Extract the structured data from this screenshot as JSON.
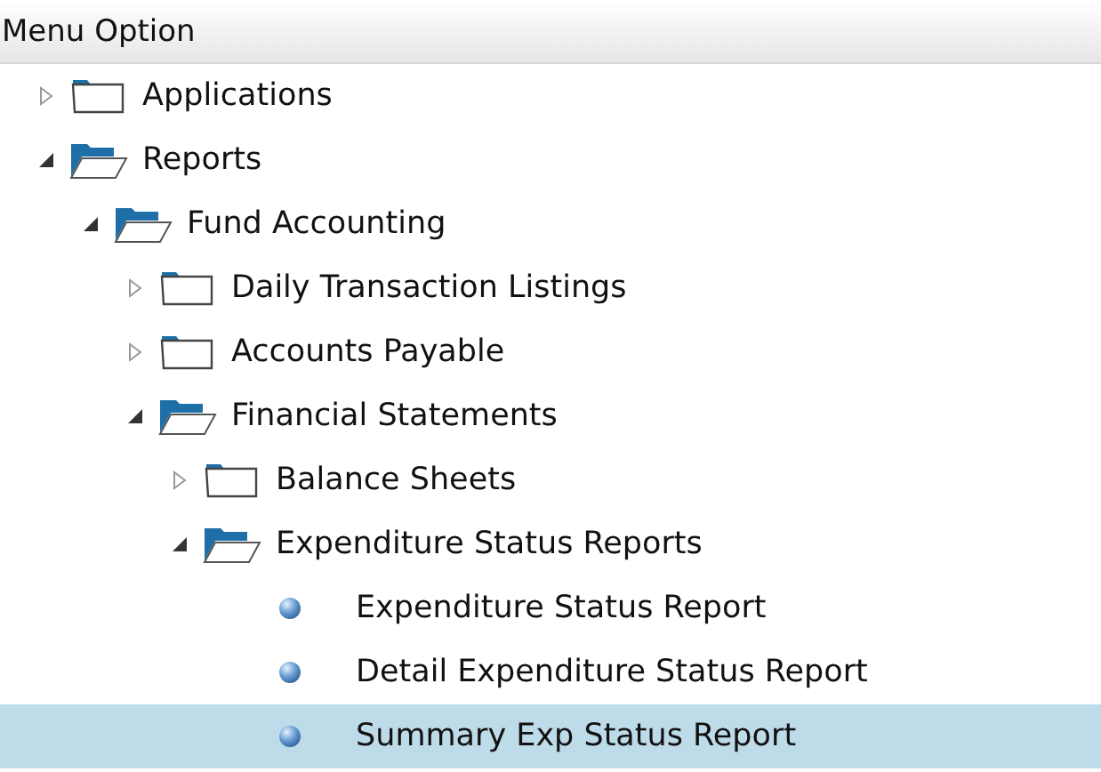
{
  "panel": {
    "title": "Menu Option"
  },
  "tree": [
    {
      "label": "Applications",
      "kind": "folder",
      "expanded": false,
      "selected": false
    },
    {
      "label": "Reports",
      "kind": "folder",
      "expanded": true,
      "selected": false,
      "children": [
        {
          "label": "Fund Accounting",
          "kind": "folder",
          "expanded": true,
          "selected": false,
          "children": [
            {
              "label": "Daily Transaction Listings",
              "kind": "folder",
              "expanded": false,
              "selected": false
            },
            {
              "label": "Accounts Payable",
              "kind": "folder",
              "expanded": false,
              "selected": false
            },
            {
              "label": "Financial Statements",
              "kind": "folder",
              "expanded": true,
              "selected": false,
              "children": [
                {
                  "label": "Balance Sheets",
                  "kind": "folder",
                  "expanded": false,
                  "selected": false
                },
                {
                  "label": "Expenditure Status Reports",
                  "kind": "folder",
                  "expanded": true,
                  "selected": false,
                  "children": [
                    {
                      "label": "Expenditure Status Report",
                      "kind": "report",
                      "selected": false
                    },
                    {
                      "label": "Detail Expenditure Status Report",
                      "kind": "report",
                      "selected": false
                    },
                    {
                      "label": "Summary Exp Status Report",
                      "kind": "report",
                      "selected": true
                    }
                  ]
                }
              ]
            }
          ]
        }
      ]
    }
  ]
}
